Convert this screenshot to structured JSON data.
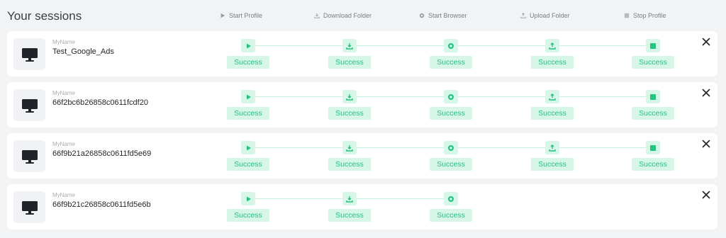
{
  "page": {
    "title": "Your sessions"
  },
  "steps": [
    {
      "label": "Start Profile",
      "icon": "play-icon"
    },
    {
      "label": "Download Folder",
      "icon": "download-icon"
    },
    {
      "label": "Start Browser",
      "icon": "browser-icon"
    },
    {
      "label": "Upload Folder",
      "icon": "upload-icon"
    },
    {
      "label": "Stop Profile",
      "icon": "stop-icon"
    }
  ],
  "colors": {
    "success": "#25c27f",
    "success_bg": "#d6f6e7",
    "icon_dark": "#22242a"
  },
  "sessions": [
    {
      "label": "MyName",
      "name": "Test_Google_Ads",
      "statuses": [
        "Success",
        "Success",
        "Success",
        "Success",
        "Success"
      ]
    },
    {
      "label": "MyName",
      "name": "66f2bc6b26858c0611fcdf20",
      "statuses": [
        "Success",
        "Success",
        "Success",
        "Success",
        "Success"
      ]
    },
    {
      "label": "MyName",
      "name": "66f9b21a26858c0611fd5e69",
      "statuses": [
        "Success",
        "Success",
        "Success",
        "Success",
        "Success"
      ]
    },
    {
      "label": "MyName",
      "name": "66f9b21c26858c0611fd5e6b",
      "statuses": [
        "Success",
        "Success",
        "Success"
      ]
    }
  ]
}
